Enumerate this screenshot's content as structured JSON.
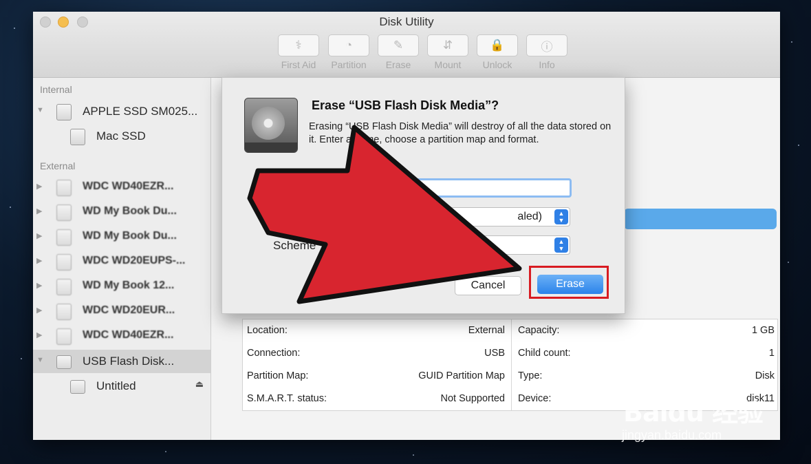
{
  "window": {
    "title": "Disk Utility"
  },
  "toolbar": {
    "buttons": [
      {
        "label": "First Aid",
        "icon": "stethoscope-icon",
        "glyph": "⚕"
      },
      {
        "label": "Partition",
        "icon": "partition-pie-icon",
        "glyph": "◔"
      },
      {
        "label": "Erase",
        "icon": "erase-disk-icon",
        "glyph": "✎"
      },
      {
        "label": "Mount",
        "icon": "mount-icon",
        "glyph": "⇵"
      },
      {
        "label": "Unlock",
        "icon": "lock-icon",
        "glyph": "🔒"
      },
      {
        "label": "Info",
        "icon": "info-icon",
        "glyph": "ⓘ"
      }
    ]
  },
  "sidebar": {
    "internal_header": "Internal",
    "external_header": "External",
    "internal_items": [
      {
        "label": "APPLE SSD SM025..."
      },
      {
        "label": "Mac SSD"
      }
    ],
    "external_items": [
      {
        "label": "WDC WD40EZR..."
      },
      {
        "label": "WD My Book Du..."
      },
      {
        "label": "WD My Book Du..."
      },
      {
        "label": "WDC WD20EUPS-..."
      },
      {
        "label": "WD My Book 12..."
      },
      {
        "label": "WDC WD20EUR..."
      },
      {
        "label": "WDC WD40EZR..."
      },
      {
        "label": "USB Flash Disk..."
      },
      {
        "label": "Untitled"
      }
    ],
    "eject_glyph": "⏏"
  },
  "info": {
    "rows": [
      {
        "k1": "Location:",
        "v1": "External",
        "k2": "Capacity:",
        "v2": "1 GB"
      },
      {
        "k1": "Connection:",
        "v1": "USB",
        "k2": "Child count:",
        "v2": "1"
      },
      {
        "k1": "Partition Map:",
        "v1": "GUID Partition Map",
        "k2": "Type:",
        "v2": "Disk"
      },
      {
        "k1": "S.M.A.R.T. status:",
        "v1": "Not Supported",
        "k2": "Device:",
        "v2": "disk11"
      }
    ]
  },
  "dialog": {
    "title": "Erase “USB Flash Disk Media”?",
    "message": "Erasing “USB Flash Disk Media” will destroy of all the data stored on it. Enter a name, choose a partition map and format.",
    "name_value": "Untitled",
    "format_value": "aled)",
    "scheme_label": "Scheme",
    "scheme_value": "G",
    "cancel_label": "Cancel",
    "erase_label": "Erase"
  },
  "colors": {
    "arrow": "#d8252f",
    "highlight": "#d81b21",
    "accent": "#2b83ea"
  },
  "watermark": {
    "logo": "Baidu 经验",
    "url": "jingyan.baidu.com"
  }
}
